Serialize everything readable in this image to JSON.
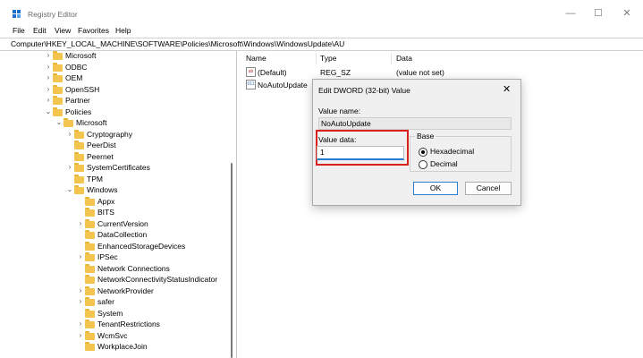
{
  "window": {
    "title": "Registry Editor",
    "minimize_glyph": "—",
    "maximize_glyph": "☐",
    "close_glyph": "✕"
  },
  "menu": [
    "File",
    "Edit",
    "View",
    "Favorites",
    "Help"
  ],
  "address": "Computer\\HKEY_LOCAL_MACHINE\\SOFTWARE\\Policies\\Microsoft\\Windows\\WindowsUpdate\\AU",
  "tree": [
    {
      "label": "Microsoft",
      "chev": ">"
    },
    {
      "label": "ODBC",
      "chev": ">"
    },
    {
      "label": "OEM",
      "chev": ">"
    },
    {
      "label": "OpenSSH",
      "chev": ">"
    },
    {
      "label": "Partner",
      "chev": ">"
    },
    {
      "label": "Policies",
      "chev": "v"
    },
    {
      "label": "Microsoft",
      "chev": "v"
    },
    {
      "label": "Cryptography",
      "chev": ">"
    },
    {
      "label": "PeerDist",
      "chev": ""
    },
    {
      "label": "Peernet",
      "chev": ""
    },
    {
      "label": "SystemCertificates",
      "chev": ">"
    },
    {
      "label": "TPM",
      "chev": ""
    },
    {
      "label": "Windows",
      "chev": "v"
    },
    {
      "label": "Appx",
      "chev": ""
    },
    {
      "label": "BITS",
      "chev": ""
    },
    {
      "label": "CurrentVersion",
      "chev": ">"
    },
    {
      "label": "DataCollection",
      "chev": ""
    },
    {
      "label": "EnhancedStorageDevices",
      "chev": ""
    },
    {
      "label": "IPSec",
      "chev": ">"
    },
    {
      "label": "Network Connections",
      "chev": ""
    },
    {
      "label": "NetworkConnectivityStatusIndicator",
      "chev": ""
    },
    {
      "label": "NetworkProvider",
      "chev": ">"
    },
    {
      "label": "safer",
      "chev": ">"
    },
    {
      "label": "System",
      "chev": ""
    },
    {
      "label": "TenantRestrictions",
      "chev": ">"
    },
    {
      "label": "WcmSvc",
      "chev": ">"
    },
    {
      "label": "WorkplaceJoin",
      "chev": ""
    }
  ],
  "list": {
    "headers": {
      "name": "Name",
      "type": "Type",
      "data": "Data"
    },
    "rows": [
      {
        "name": "(Default)",
        "type": "REG_SZ",
        "data": "(value not set)",
        "icon": "string-value-icon"
      },
      {
        "name": "NoAutoUpdate",
        "type": "",
        "data": "",
        "icon": "dword-value-icon"
      }
    ]
  },
  "dialog": {
    "title": "Edit DWORD (32-bit) Value",
    "close_glyph": "✕",
    "value_name_label": "Value name:",
    "value_name": "NoAutoUpdate",
    "value_data_label": "Value data:",
    "value_data": "1",
    "base_label": "Base",
    "hex_label": "Hexadecimal",
    "dec_label": "Decimal",
    "ok_label": "OK",
    "cancel_label": "Cancel"
  }
}
